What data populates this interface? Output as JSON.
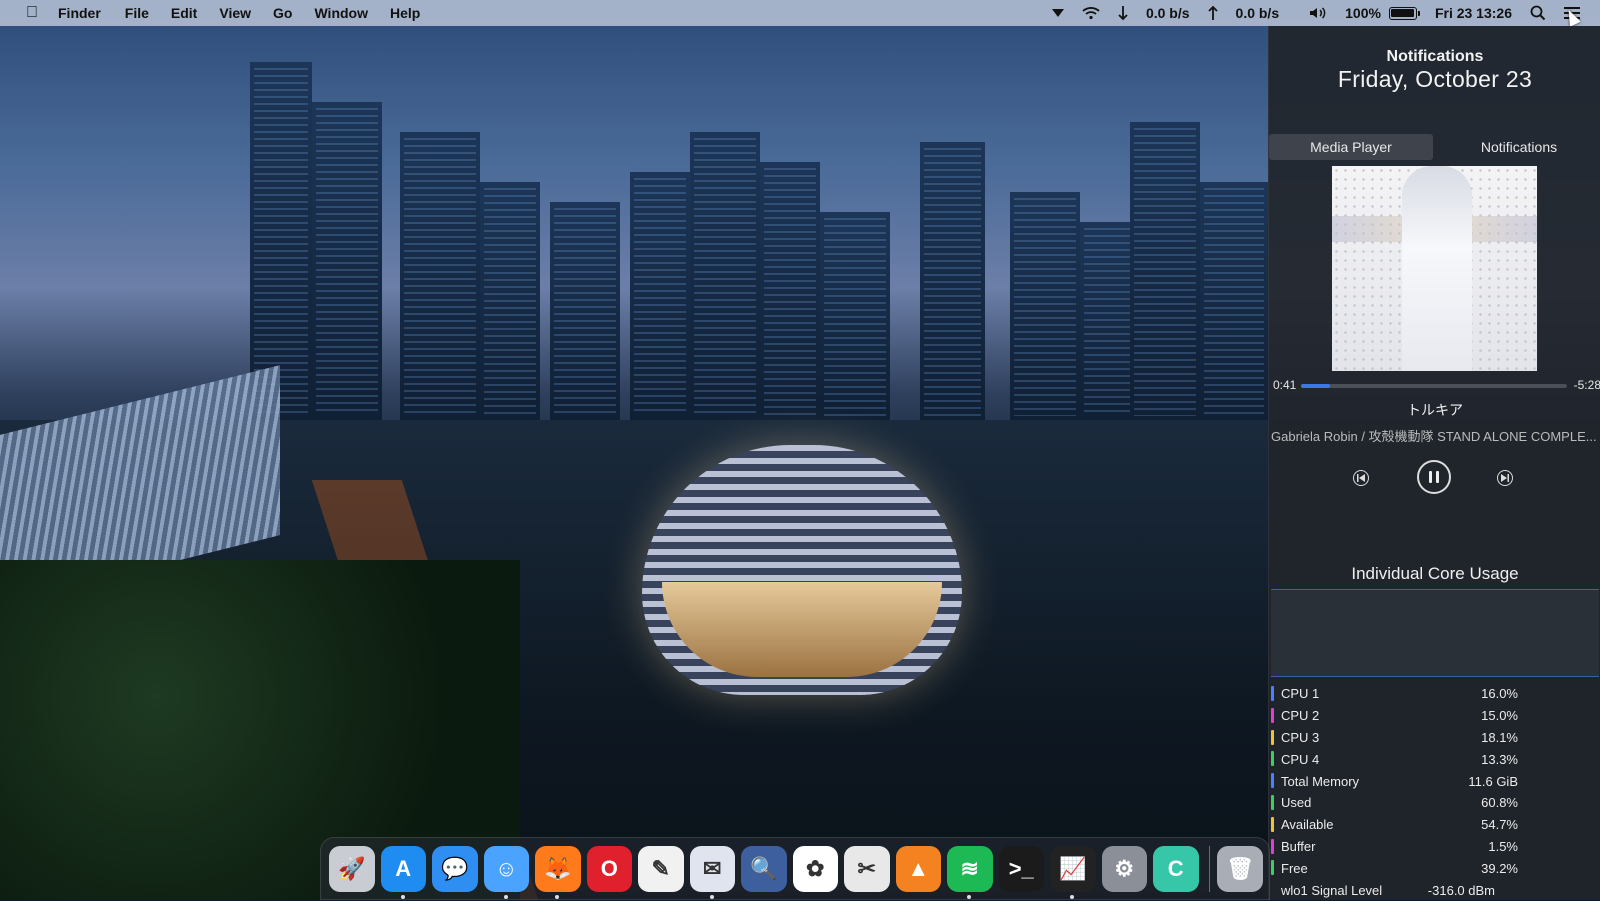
{
  "menubar": {
    "app_name": "Finder",
    "menus": [
      "File",
      "Edit",
      "View",
      "Go",
      "Window",
      "Help"
    ],
    "download_rate": "0.0 b/s",
    "upload_rate": "0.0 b/s",
    "battery": "100%",
    "clock": "Fri 23 13:26"
  },
  "panel": {
    "title": "Notifications",
    "date": "Friday, October 23",
    "tabs": [
      "Media Player",
      "Notifications"
    ],
    "media": {
      "elapsed": "0:41",
      "remaining": "-5:28",
      "progress_fraction": 0.11,
      "song": "トルキア",
      "artist": "Gabriela Robin / 攻殻機動隊 STAND ALONE COMPLE..."
    },
    "core_title": "Individual Core Usage",
    "stats": [
      {
        "label": "CPU 1",
        "value": "16.0%",
        "color": "#4a7fff"
      },
      {
        "label": "CPU 2",
        "value": "15.0%",
        "color": "#e040d0"
      },
      {
        "label": "CPU 3",
        "value": "18.1%",
        "color": "#f2c230"
      },
      {
        "label": "CPU 4",
        "value": "13.3%",
        "color": "#3ccf5e"
      },
      {
        "label": "Total Memory",
        "value": "11.6 GiB",
        "color": "#4a7fff"
      },
      {
        "label": "Used",
        "value": "60.8%",
        "color": "#3ccf5e"
      },
      {
        "label": "Available",
        "value": "54.7%",
        "color": "#f2c230"
      },
      {
        "label": "Buffer",
        "value": "1.5%",
        "color": "#e040d0"
      },
      {
        "label": "Free",
        "value": "39.2%",
        "color": "#3ccf5e"
      }
    ],
    "signal": {
      "label": "wlo1 Signal Level",
      "value": "-316.0 dBm"
    }
  },
  "dock": {
    "apps": [
      {
        "name": "launchpad-icon",
        "glyph": "🚀",
        "bg": "#c9ccd3"
      },
      {
        "name": "app-store-icon",
        "glyph": "A",
        "bg": "#1e8cf0"
      },
      {
        "name": "messages-icon",
        "glyph": "💬",
        "bg": "#2f8ef2"
      },
      {
        "name": "finder-icon",
        "glyph": "☺",
        "bg": "#4aa3ff"
      },
      {
        "name": "firefox-icon",
        "glyph": "🦊",
        "bg": "#ff7a1a"
      },
      {
        "name": "opera-icon",
        "glyph": "O",
        "bg": "#e0202c"
      },
      {
        "name": "textedit-icon",
        "glyph": "✎",
        "bg": "#f1f1f1"
      },
      {
        "name": "preview-icon",
        "glyph": "✉",
        "bg": "#dfe4ee"
      },
      {
        "name": "image-capture-icon",
        "glyph": "🔍",
        "bg": "#3e5f9e"
      },
      {
        "name": "photos-icon",
        "glyph": "✿",
        "bg": "#ffffff"
      },
      {
        "name": "screenshot-icon",
        "glyph": "✂",
        "bg": "#e8e8e8"
      },
      {
        "name": "vlc-icon",
        "glyph": "▲",
        "bg": "#f58220"
      },
      {
        "name": "spotify-icon",
        "glyph": "≋",
        "bg": "#1db954"
      },
      {
        "name": "terminal-icon",
        "glyph": ">_",
        "bg": "#1b1b1b"
      },
      {
        "name": "activity-monitor-icon",
        "glyph": "📈",
        "bg": "#222"
      },
      {
        "name": "system-preferences-icon",
        "glyph": "⚙",
        "bg": "#8a8f98"
      },
      {
        "name": "cleaner-icon",
        "glyph": "C",
        "bg": "#36c7a8"
      }
    ],
    "trash": {
      "name": "trash-icon",
      "glyph": "🗑",
      "bg": "#a9adb6"
    }
  }
}
